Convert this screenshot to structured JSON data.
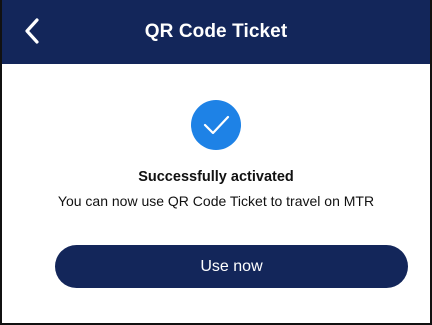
{
  "header": {
    "back_icon": "chevron-left-icon",
    "title": "QR Code Ticket"
  },
  "status": {
    "icon": "check-circle-icon",
    "title": "Successfully activated",
    "message": "You can now use QR Code Ticket to travel on MTR"
  },
  "actions": {
    "primary_label": "Use now"
  },
  "colors": {
    "brand_navy": "#13265a",
    "success_blue": "#1e82e6",
    "text": "#111111",
    "background": "#ffffff"
  }
}
